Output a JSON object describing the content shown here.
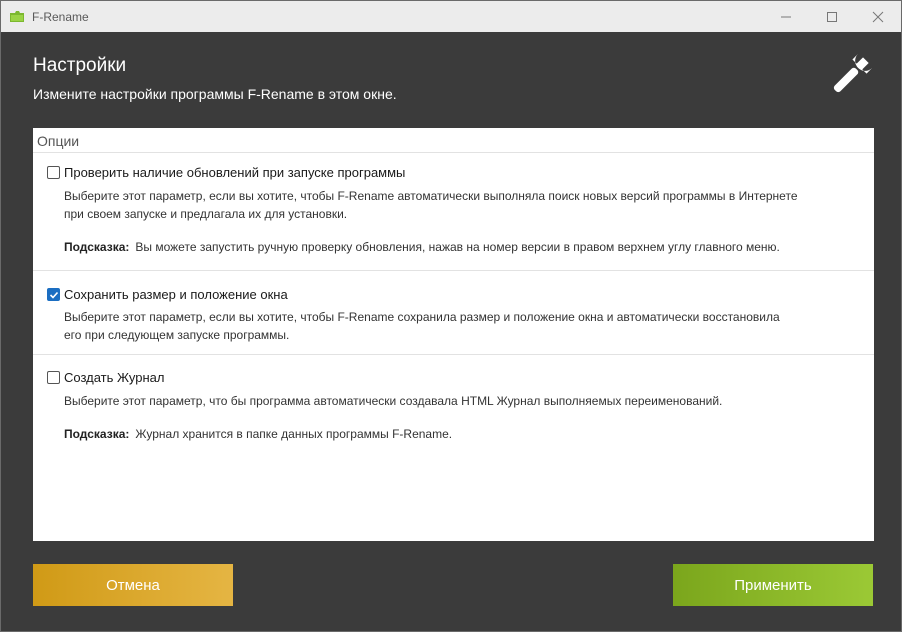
{
  "window": {
    "title": "F-Rename",
    "app_icon": "green-folder-icon",
    "controls": [
      "minimize-icon",
      "maximize-icon",
      "close-icon"
    ]
  },
  "header": {
    "title": "Настройки",
    "subtitle": "Измените настройки программы F-Rename в этом окне.",
    "icon": "wrench-icon"
  },
  "options_panel": {
    "label": "Опции",
    "items": [
      {
        "label": "Проверить наличие обновлений при запуске программы",
        "checked": false,
        "description_line1": "Выберите этот параметр, если вы хотите, чтобы F-Rename автоматически выполняла поиск новых версий программы в Интернете",
        "description_line2": "при своем запуске и предлагала их для установки.",
        "hint_label": "Подсказка:",
        "hint_text": "Вы можете запустить ручную проверку обновления, нажав на номер версии в правом верхнем углу главного меню."
      },
      {
        "label": "Сохранить размер и положение окна",
        "checked": true,
        "description_line1": "Выберите этот параметр, если вы хотите, чтобы F-Rename сохранила размер и положение окна и автоматически восстановила",
        "description_line2": "его при следующем запуске программы."
      },
      {
        "label": "Создать Журнал",
        "checked": false,
        "description_line1": "Выберите этот параметр, что бы программа автоматически создавала HTML Журнал выполняемых переименований.",
        "hint_label": "Подсказка:",
        "hint_text": "Журнал хранится в папке данных программы F-Rename."
      }
    ]
  },
  "buttons": {
    "cancel": "Отмена",
    "apply": "Применить"
  },
  "colors": {
    "background": "#3b3b3b",
    "cancel_button": "#d9a52c",
    "apply_button": "#8dbb2a",
    "checkbox_checked": "#1b6ec2"
  }
}
